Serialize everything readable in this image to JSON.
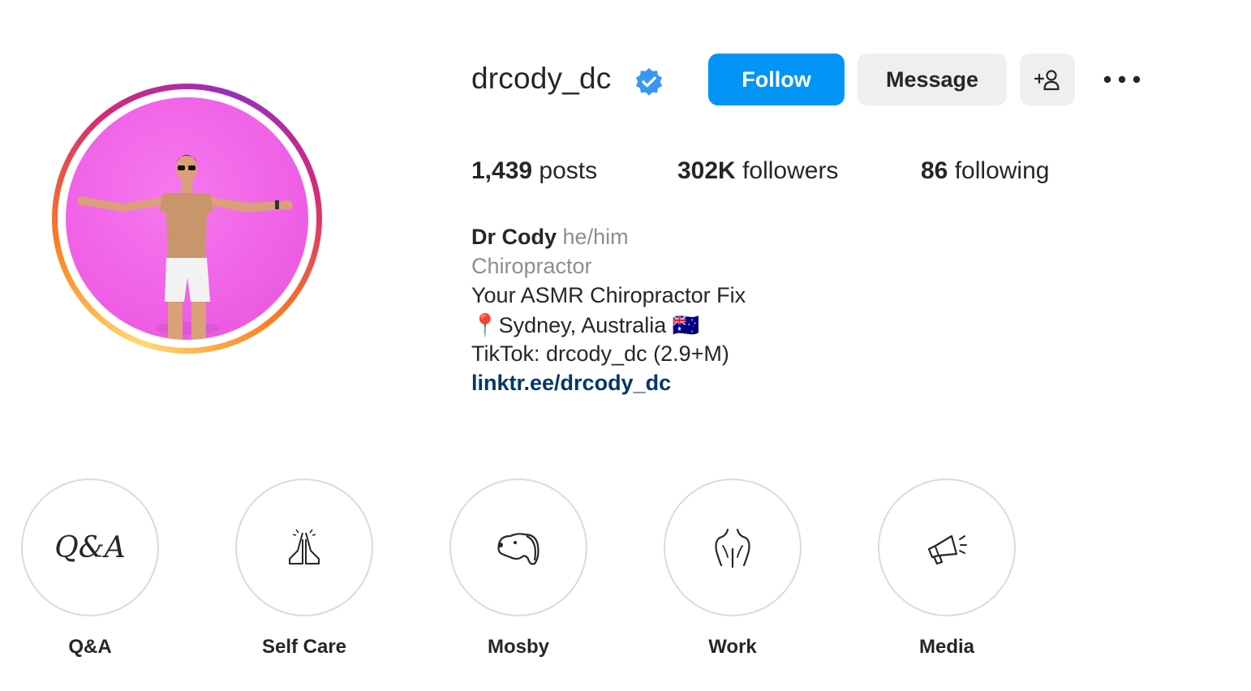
{
  "profile": {
    "username": "drcody_dc",
    "verified": true,
    "follow_label": "Follow",
    "message_label": "Message"
  },
  "stats": {
    "posts_count": "1,439",
    "posts_label": "posts",
    "followers_count": "302K",
    "followers_label": "followers",
    "following_count": "86",
    "following_label": "following"
  },
  "bio": {
    "name": "Dr Cody",
    "pronouns": "he/him",
    "category": "Chiropractor",
    "line1": "Your ASMR Chiropractor Fix",
    "location_pin": "📍",
    "location": "Sydney, Australia",
    "flag": "🇦🇺",
    "tiktok": "TikTok: drcody_dc (2.9+M)",
    "link": "linktr.ee/drcody_dc"
  },
  "highlights": [
    {
      "label": "Q&A",
      "icon": "qa-text-icon",
      "icon_text": "Q&A"
    },
    {
      "label": "Self Care",
      "icon": "praying-hands-icon"
    },
    {
      "label": "Mosby",
      "icon": "dog-icon"
    },
    {
      "label": "Work",
      "icon": "spine-back-icon"
    },
    {
      "label": "Media",
      "icon": "megaphone-icon"
    }
  ],
  "colors": {
    "follow_blue": "#0095f6",
    "verified_blue": "#3897f0",
    "link_blue": "#00376b",
    "button_gray": "#efefef",
    "muted_text": "#8e8e8e",
    "avatar_background": "#f06be8"
  }
}
